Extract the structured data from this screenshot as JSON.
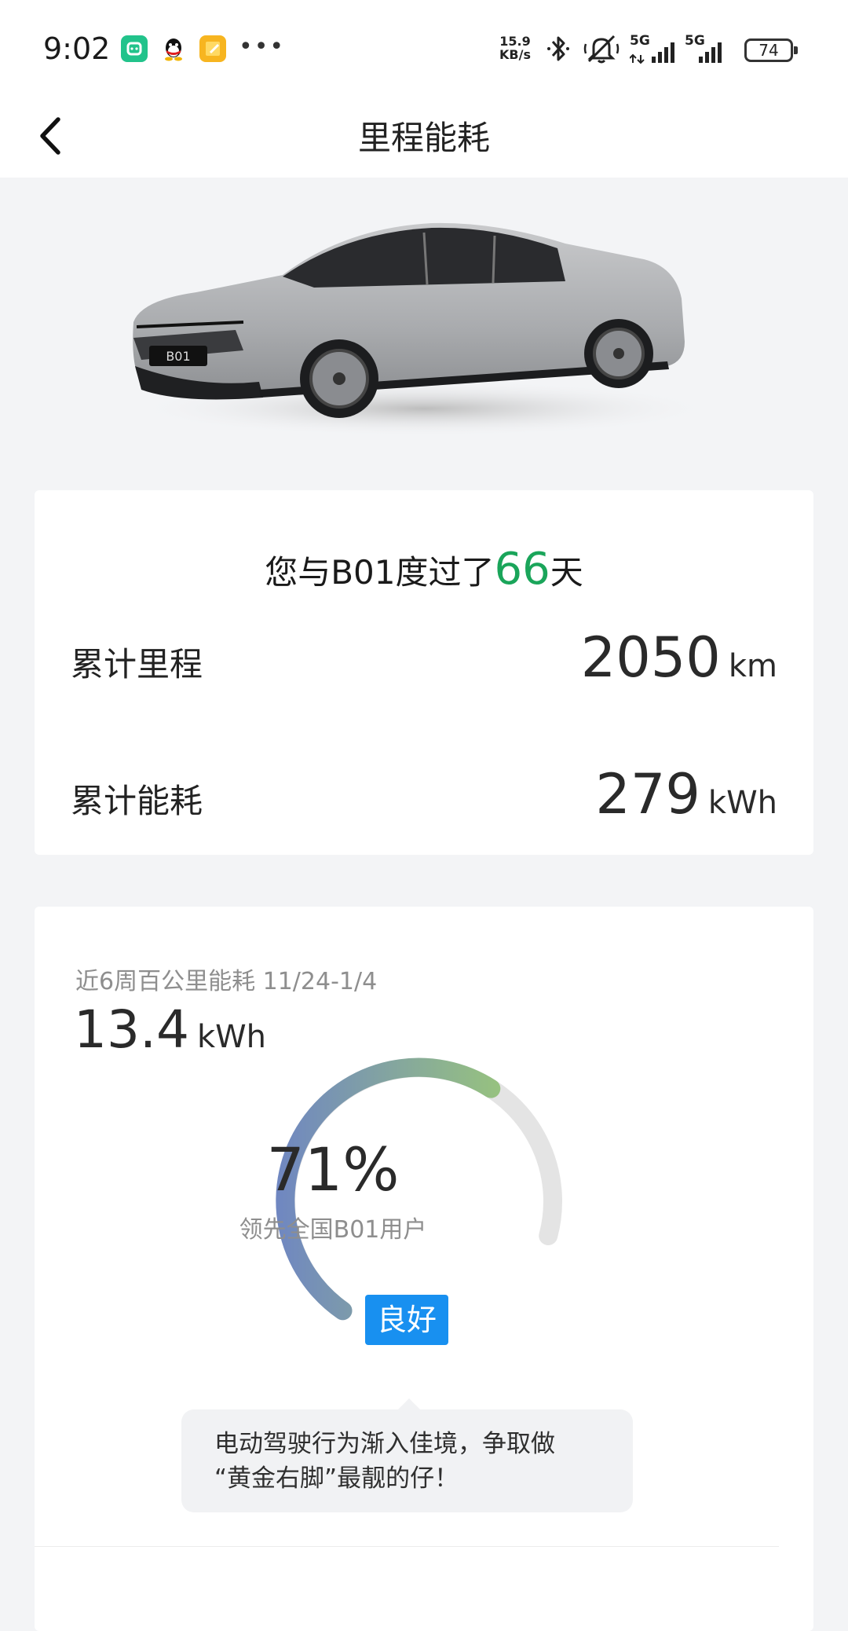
{
  "status_bar": {
    "time": "9:02",
    "network_speed_value": "15.9",
    "network_speed_unit": "KB/s",
    "signal_1": "5G",
    "signal_2": "5G",
    "battery": "74",
    "icons": [
      "mi-home-app-icon",
      "qq-app-icon",
      "notes-app-icon",
      "more-notifications-icon",
      "bluetooth-icon",
      "mute-icon",
      "signal-icon",
      "signal-icon",
      "battery-icon"
    ]
  },
  "header": {
    "title": "里程能耗",
    "back_icon": "chevron-left-icon"
  },
  "summary": {
    "days_prefix": "您与B01度过了",
    "days": "66",
    "days_suffix": "天",
    "mileage_label": "累计里程",
    "mileage_value": "2050",
    "mileage_unit": "km",
    "energy_label": "累计能耗",
    "energy_value": "279",
    "energy_unit": "kWh"
  },
  "weekly": {
    "label": "近6周百公里能耗 11/24-1/4",
    "value": "13.4",
    "unit": "kWh",
    "percent_text": "71%",
    "percent_fraction": 0.71,
    "percent_subtitle": "领先全国B01用户",
    "rating": "良好",
    "tip_line1": "电动驾驶行为渐入佳境，争取做",
    "tip_line2": "“黄金右脚”最靓的仔！",
    "colors": {
      "gauge_start": "#6f86c2",
      "gauge_end": "#a2d36c",
      "track": "#e4e4e4",
      "badge": "#1890f0",
      "highlight": "#1aa55a"
    }
  }
}
